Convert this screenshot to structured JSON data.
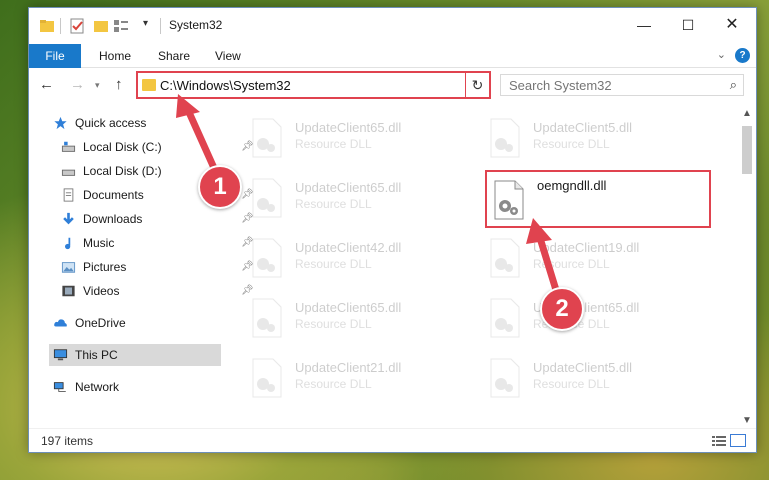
{
  "window": {
    "title": "System32",
    "controls": {
      "minimize": "—",
      "maximize": "☐",
      "close": "✕"
    }
  },
  "ribbon": {
    "tabs": [
      "File",
      "Home",
      "Share",
      "View"
    ],
    "help": "?"
  },
  "navigation": {
    "address": "C:\\Windows\\System32",
    "search_placeholder": "Search System32"
  },
  "sidebar": {
    "items": [
      {
        "label": "Quick access",
        "icon": "star-icon",
        "pinned": false
      },
      {
        "label": "Local Disk (C:)",
        "icon": "drive-icon",
        "pinned": true
      },
      {
        "label": "Local Disk (D:)",
        "icon": "drive-icon",
        "pinned": false
      },
      {
        "label": "Documents",
        "icon": "documents-icon",
        "pinned": true
      },
      {
        "label": "Downloads",
        "icon": "download-icon",
        "pinned": true
      },
      {
        "label": "Music",
        "icon": "music-icon",
        "pinned": true
      },
      {
        "label": "Pictures",
        "icon": "pictures-icon",
        "pinned": true
      },
      {
        "label": "Videos",
        "icon": "videos-icon",
        "pinned": true
      },
      {
        "label": "OneDrive",
        "icon": "cloud-icon",
        "pinned": false
      },
      {
        "label": "This PC",
        "icon": "computer-icon",
        "pinned": false,
        "selected": true
      },
      {
        "label": "Network",
        "icon": "network-icon",
        "pinned": false
      }
    ]
  },
  "files": [
    {
      "name": "UpdateClient65.dll",
      "type": "Resource DLL",
      "faded": true
    },
    {
      "name": "UpdateClient5.dll",
      "type": "Resource DLL",
      "faded": true
    },
    {
      "name": "UpdateClient65.dll",
      "type": "Resource DLL",
      "faded": true
    },
    {
      "name": "oemgndll.dll",
      "type": "",
      "faded": false
    },
    {
      "name": "UpdateClient42.dll",
      "type": "Resource DLL",
      "faded": true
    },
    {
      "name": "UpdateClient19.dll",
      "type": "Resource DLL",
      "faded": true
    },
    {
      "name": "UpdateClient65.dll",
      "type": "Resource DLL",
      "faded": true
    },
    {
      "name": "UpdateClient65.dll",
      "type": "Resource DLL",
      "faded": true
    },
    {
      "name": "UpdateClient21.dll",
      "type": "Resource DLL",
      "faded": true
    },
    {
      "name": "UpdateClient5.dll",
      "type": "Resource DLL",
      "faded": true
    }
  ],
  "status": {
    "item_count": "197 items"
  },
  "annotations": {
    "step1": "1",
    "step2": "2",
    "accent_color": "#e0434f"
  }
}
